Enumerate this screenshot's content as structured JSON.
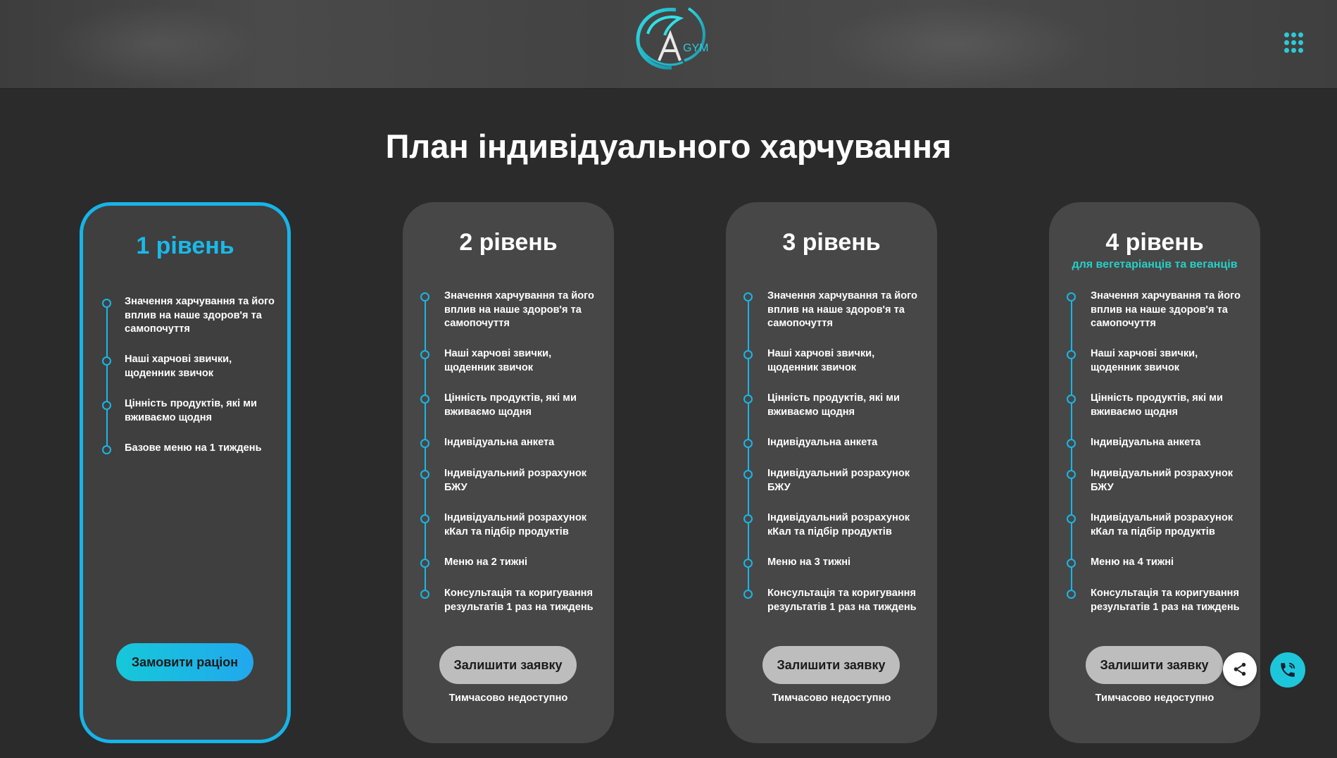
{
  "colors": {
    "accent": "#1ab6e6",
    "accent_teal": "#26d0c8",
    "card_bg": "#474747",
    "page_bg": "#2b2b2b",
    "header_bg": "#444444",
    "button_gray": "#bdbdbd"
  },
  "header": {
    "logo_text": "GYM",
    "logo_letter": "A",
    "menu_icon": "grid-dots-icon"
  },
  "page_title": "План індивідуального харчування",
  "plans": [
    {
      "title": "1 рівень",
      "subtitle": "",
      "features": [
        "Значення харчування та його вплив на наше здоров'я та самопочуття",
        "Наші харчові звички, щоденник звичок",
        "Цінність продуктів, які ми вживаємо щодня",
        "Базове меню на 1 тиждень"
      ],
      "button_label": "Замовити раціон",
      "note": ""
    },
    {
      "title": "2 рівень",
      "subtitle": "",
      "features": [
        "Значення харчування та його вплив на наше здоров'я та самопочуття",
        "Наші харчові звички, щоденник звичок",
        "Цінність продуктів, які ми вживаємо щодня",
        "Індивідуальна анкета",
        "Індивідуальний розрахунок БЖУ",
        "Індивідуальний розрахунок кКал та підбір продуктів",
        "Меню на 2 тижні",
        "Консультація та коригування результатів 1 раз на тиждень"
      ],
      "button_label": "Залишити заявку",
      "note": "Тимчасово недоступно"
    },
    {
      "title": "3 рівень",
      "subtitle": "",
      "features": [
        "Значення харчування та його вплив на наше здоров'я та самопочуття",
        "Наші харчові звички, щоденник звичок",
        "Цінність продуктів, які ми вживаємо щодня",
        "Індивідуальна анкета",
        "Індивідуальний розрахунок БЖУ",
        "Індивідуальний розрахунок кКал та підбір продуктів",
        "Меню на 3 тижні",
        "Консультація та коригування результатів 1 раз на тиждень"
      ],
      "button_label": "Залишити заявку",
      "note": "Тимчасово недоступно"
    },
    {
      "title": "4 рівень",
      "subtitle": "для вегетаріанців та веганців",
      "features": [
        "Значення харчування та його вплив на наше здоров'я та самопочуття",
        "Наші харчові звички, щоденник звичок",
        "Цінність продуктів, які ми вживаємо щодня",
        "Індивідуальна анкета",
        "Індивідуальний розрахунок БЖУ",
        "Індивідуальний розрахунок кКал та підбір продуктів",
        "Меню на 4 тижні",
        "Консультація та коригування результатів 1 раз на тиждень"
      ],
      "button_label": "Залишити заявку",
      "note": "Тимчасово недоступно"
    }
  ],
  "floating": {
    "share_icon": "share-icon",
    "phone_icon": "phone-icon"
  }
}
